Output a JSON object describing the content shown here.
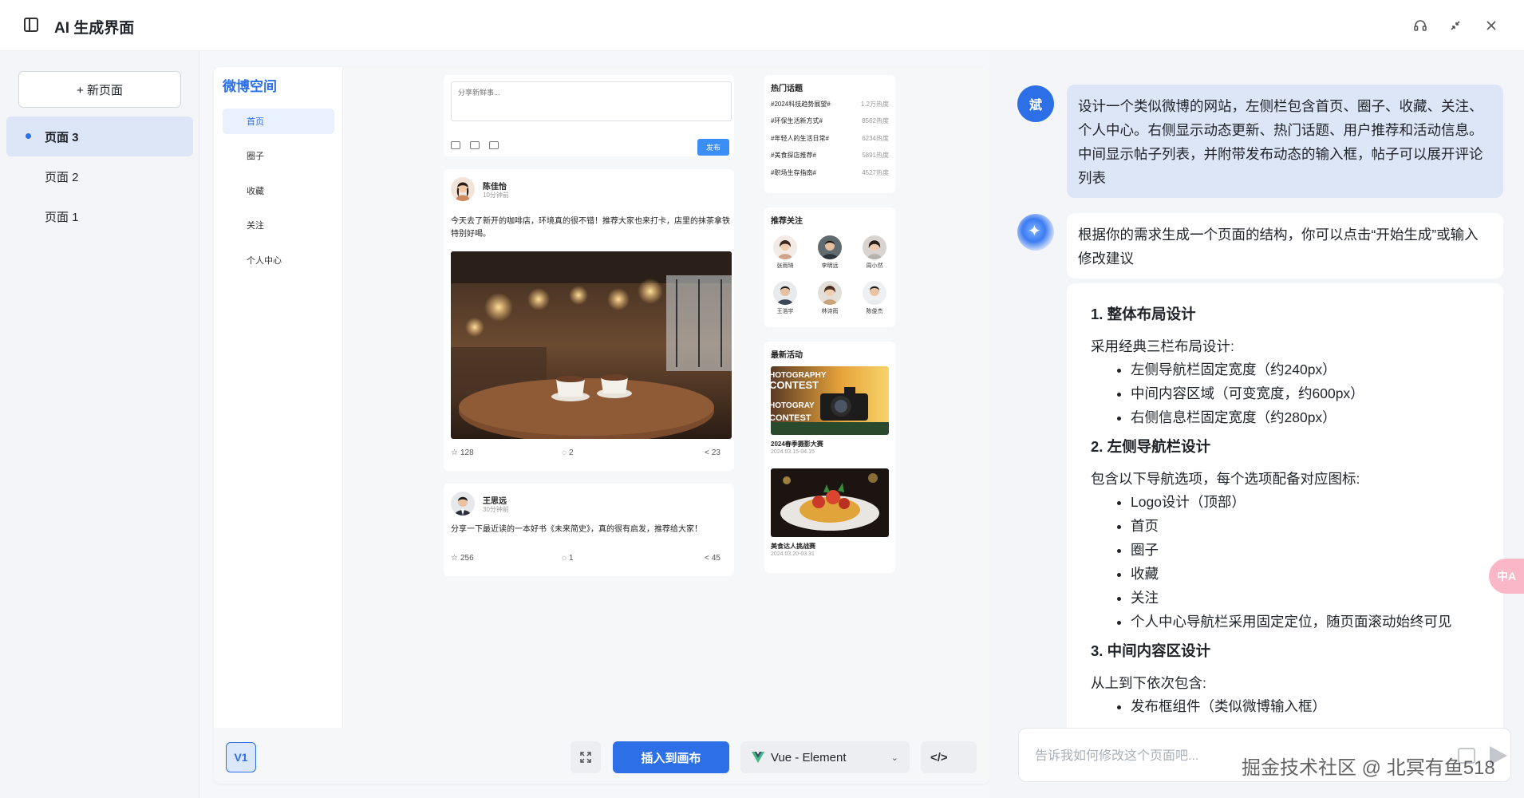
{
  "app": {
    "title": "AI 生成界面"
  },
  "topbar": {
    "icons": [
      "headset-icon",
      "minimize-icon",
      "close-icon"
    ]
  },
  "sidebar": {
    "new_page_label": "+ 新页面",
    "pages": [
      {
        "label": "页面 3",
        "active": true
      },
      {
        "label": "页面 2",
        "active": false
      },
      {
        "label": "页面 1",
        "active": false
      }
    ]
  },
  "preview": {
    "logo": "微博空间",
    "nav": [
      {
        "label": "首页",
        "active": true
      },
      {
        "label": "圈子"
      },
      {
        "label": "收藏"
      },
      {
        "label": "关注"
      },
      {
        "label": "个人中心"
      }
    ],
    "composer": {
      "placeholder": "分享新鲜事...",
      "publish_label": "发布"
    },
    "posts": [
      {
        "author": "陈佳怡",
        "time": "10分钟前",
        "content": "今天去了新开的咖啡店，环境真的很不错！推荐大家也来打卡，店里的抹茶拿铁特别好喝。",
        "likes": "128",
        "comments": "2",
        "shares": "23"
      },
      {
        "author": "王思远",
        "time": "30分钟前",
        "content": "分享一下最近读的一本好书《未来简史》，真的很有启发，推荐给大家！",
        "likes": "256",
        "comments": "1",
        "shares": "45"
      }
    ],
    "hot_topics": {
      "title": "热门话题",
      "items": [
        {
          "topic": "#2024科技趋势展望#",
          "heat": "1.2万热度"
        },
        {
          "topic": "#环保生活新方式#",
          "heat": "8562热度"
        },
        {
          "topic": "#年轻人的生活日常#",
          "heat": "6234热度"
        },
        {
          "topic": "#美食探店推荐#",
          "heat": "5891热度"
        },
        {
          "topic": "#职场生存指南#",
          "heat": "4527热度"
        }
      ]
    },
    "recommend": {
      "title": "推荐关注",
      "users": [
        "张雨琦",
        "李明远",
        "周小然",
        "王浩宇",
        "林诗雨",
        "陈俊杰"
      ]
    },
    "events": {
      "title": "最新活动",
      "items": [
        {
          "title": "2024春季摄影大赛",
          "date": "2024.03.15-04.15",
          "banner_lines": [
            "HOTOGRAPHY",
            "CONTEST",
            "HOTOGRAY",
            "CONTEST"
          ]
        },
        {
          "title": "美食达人挑战赛",
          "date": "2024.03.20-03.31"
        }
      ]
    }
  },
  "toolbar": {
    "version": "V1",
    "insert_label": "插入到画布",
    "framework": "Vue - Element",
    "code_label": "</>"
  },
  "chat": {
    "user_avatar_text": "斌",
    "user_message": "设计一个类似微博的网站，左侧栏包含首页、圈子、收藏、关注、个人中心。右侧显示动态更新、热门话题、用户推荐和活动信息。中间显示帖子列表，并附带发布动态的输入框，帖子可以展开评论列表",
    "ai_intro": "根据你的需求生成一个页面的结构，你可以点击“开始生成”或输入修改建议",
    "sections": [
      {
        "heading": "1. 整体布局设计",
        "intro": "采用经典三栏布局设计:",
        "items": [
          "左侧导航栏固定宽度（约240px）",
          "中间内容区域（可变宽度，约600px）",
          "右侧信息栏固定宽度（约280px）"
        ]
      },
      {
        "heading": "2. 左侧导航栏设计",
        "intro": "包含以下导航选项，每个选项配备对应图标:",
        "items": [
          "Logo设计（顶部）",
          "首页",
          "圈子",
          "收藏",
          "关注",
          "个人中心导航栏采用固定定位，随页面滚动始终可见"
        ]
      },
      {
        "heading": "3. 中间内容区设计",
        "intro": "从上到下依次包含:",
        "items": [
          "发布框组件（类似微博输入框）"
        ]
      }
    ],
    "input_placeholder": "告诉我如何修改这个页面吧...",
    "watermark": "掘金技术社区 @ 北冥有鱼518",
    "translate_label": "中A"
  },
  "colors": {
    "accent": "#2d6fe6",
    "sidebar_bg": "#f3f5f9",
    "user_bubble": "#dde6f6"
  }
}
